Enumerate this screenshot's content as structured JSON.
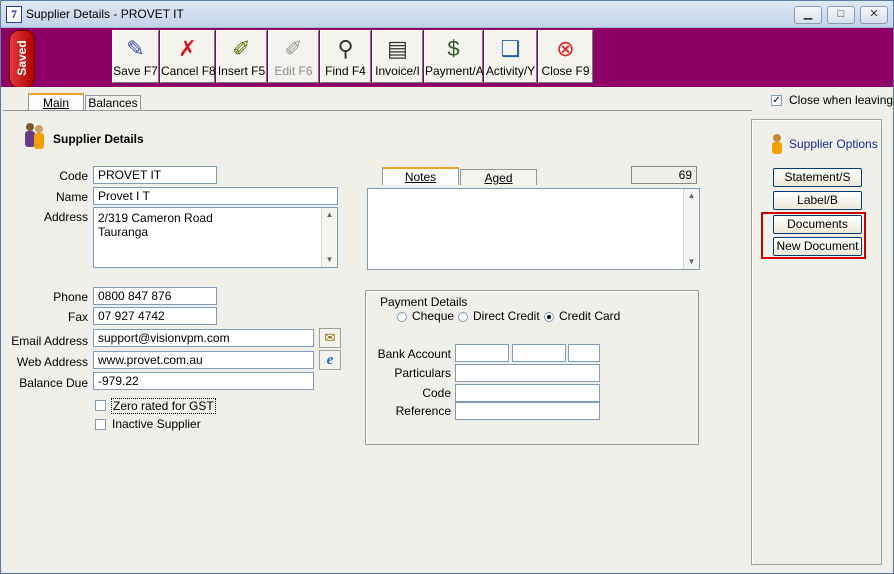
{
  "window": {
    "title": "Supplier Details - PROVET IT",
    "app_icon_glyph": "7",
    "minimize": "▁",
    "maximize": "□",
    "close": "✕"
  },
  "saved_badge": "Saved",
  "toolbar": {
    "buttons": [
      {
        "label": "Save F7",
        "icon": "pen-icon",
        "glyph": "✎",
        "color": "#3a4fb5",
        "enabled": true
      },
      {
        "label": "Cancel F8",
        "icon": "x-icon",
        "glyph": "✗",
        "color": "#d21818",
        "enabled": true
      },
      {
        "label": "Insert F5",
        "icon": "pencil-paper-icon",
        "glyph": "✐",
        "color": "#556b00",
        "enabled": true
      },
      {
        "label": "Edit F6",
        "icon": "edit-paper-icon",
        "glyph": "✐",
        "color": "#9a9a9a",
        "enabled": false
      },
      {
        "label": "Find F4",
        "icon": "magnifier-icon",
        "glyph": "⚲",
        "color": "#333333",
        "enabled": true
      },
      {
        "label": "Invoice/I",
        "icon": "invoice-icon",
        "glyph": "▤",
        "color": "#333333",
        "enabled": true
      },
      {
        "label": "Payment/A",
        "icon": "money-bag-icon",
        "glyph": "$",
        "color": "#2d5a1e",
        "enabled": true
      },
      {
        "label": "Activity/Y",
        "icon": "scroll-icon",
        "glyph": "❑",
        "color": "#2b5fa8",
        "enabled": true
      },
      {
        "label": "Close F9",
        "icon": "close-circle-icon",
        "glyph": "⊗",
        "color": "#e02020",
        "enabled": true
      }
    ]
  },
  "tabs": {
    "main": "Main",
    "balances": "Balances"
  },
  "close_when_leaving": {
    "label": "Close when leaving",
    "checked": true
  },
  "section_title": "Supplier Details",
  "form": {
    "code_label": "Code",
    "code": "PROVET IT",
    "name_label": "Name",
    "name": "Provet I T",
    "address_label": "Address",
    "address_line1": "2/319 Cameron Road",
    "address_line2": "Tauranga",
    "phone_label": "Phone",
    "phone": "0800 847 876",
    "fax_label": "Fax",
    "fax": "07 927 4742",
    "email_label": "Email Address",
    "email": "support@visionvpm.com",
    "web_label": "Web Address",
    "web": "www.provet.com.au",
    "balance_label": "Balance Due",
    "balance": "-979.22",
    "zero_rated_label": "Zero rated for GST",
    "zero_rated_checked": false,
    "inactive_label": "Inactive Supplier",
    "inactive_checked": false
  },
  "notes": {
    "tab_notes": "Notes",
    "tab_aged": "Aged Analysis",
    "count": "69",
    "text": ""
  },
  "payment": {
    "title": "Payment Details",
    "options": [
      "Cheque",
      "Direct Credit",
      "Credit Card"
    ],
    "selected": "Credit Card",
    "bank_account_label": "Bank Account",
    "particulars_label": "Particulars",
    "code_label": "Code",
    "reference_label": "Reference"
  },
  "options": {
    "title": "Supplier Options",
    "statement": "Statement/S",
    "label": "Label/B",
    "documents": "Documents",
    "new_document": "New Document",
    "highlight_color": "#cc0000"
  }
}
